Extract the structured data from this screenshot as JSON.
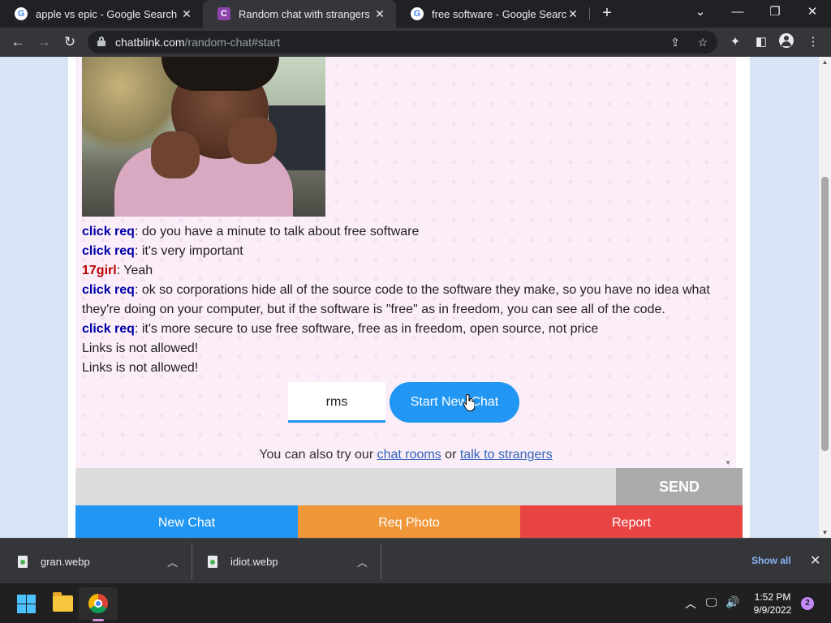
{
  "browser": {
    "tabs": [
      {
        "title": "apple vs epic - Google Search",
        "favicon": "google-icon",
        "active": false
      },
      {
        "title": "Random chat with strangers",
        "favicon": "chatblink-icon",
        "active": true
      },
      {
        "title": "free software - Google Search",
        "favicon": "google-icon",
        "active": false
      }
    ],
    "new_tab_label": "+",
    "url_host": "chatblink.com",
    "url_path": "/random-chat#start"
  },
  "chat": {
    "messages": [
      {
        "sender": "click req",
        "text": ": do you have a minute to talk about free software"
      },
      {
        "sender": "click req",
        "text": ": it's very important"
      },
      {
        "sender": "17girl",
        "text": ": Yeah"
      },
      {
        "sender": "click req",
        "text": ": ok so corporations hide all of the source code to the software they make, so you have no idea what they're doing on your computer, but if the software is \"free\" as in freedom, you can see all of the code."
      },
      {
        "sender": "click req",
        "text": ": it's more secure to use free software, free as in freedom, open source, not price"
      },
      {
        "sender": "",
        "text": "Links is not allowed!"
      },
      {
        "sender": "",
        "text": "Links is not allowed!"
      }
    ],
    "nickname_value": "rms",
    "start_button": "Start New Chat",
    "also_prefix": "You can also try our ",
    "chat_rooms_link": "chat rooms",
    "also_or": " or ",
    "strangers_link": "talk to strangers",
    "send_button": "SEND",
    "new_chat_button": "New Chat",
    "req_photo_button": "Req Photo",
    "report_button": "Report",
    "colors": {
      "blue": "#2196f3",
      "orange": "#f0973a",
      "red": "#e84444",
      "sender": "#0000a8",
      "girl": "#c00000"
    }
  },
  "downloads": {
    "items": [
      {
        "name": "gran.webp"
      },
      {
        "name": "idiot.webp"
      }
    ],
    "show_all": "Show all"
  },
  "taskbar": {
    "time": "1:52 PM",
    "date": "9/9/2022",
    "notification_count": "2"
  }
}
